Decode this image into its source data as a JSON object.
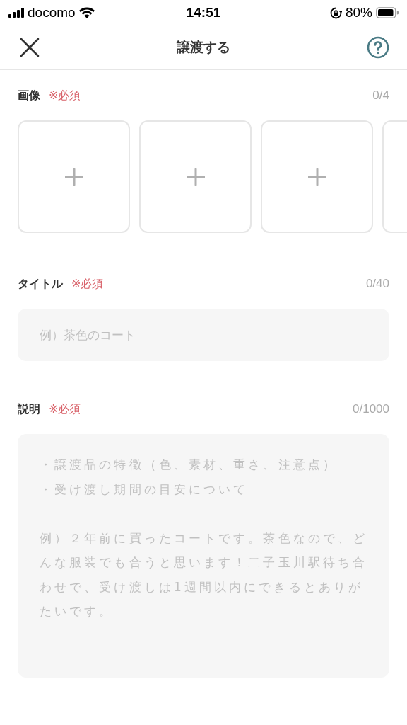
{
  "status_bar": {
    "carrier": "docomo",
    "time": "14:51",
    "battery": "80%"
  },
  "nav": {
    "title": "譲渡する"
  },
  "images": {
    "label": "画像",
    "required": "※必須",
    "counter": "0/4",
    "slots": [
      {
        "kind": "add"
      },
      {
        "kind": "add"
      },
      {
        "kind": "add"
      },
      {
        "kind": "cut_off"
      }
    ]
  },
  "title_field": {
    "label": "タイトル",
    "required": "※必須",
    "counter": "0/40",
    "placeholder": "例）茶色のコート"
  },
  "description_field": {
    "label": "説明",
    "required": "※必須",
    "counter": "0/1000",
    "placeholder": [
      "・譲渡品の特徴（色、素材、重さ、注意点）",
      "・受け渡し期間の目安について",
      "例）２年前に買ったコートです。茶色なので、どんな服装でも合うと思います！二子玉川駅待ち合わせで、受け渡しは1週間以内にできるとありがたいです。"
    ]
  }
}
